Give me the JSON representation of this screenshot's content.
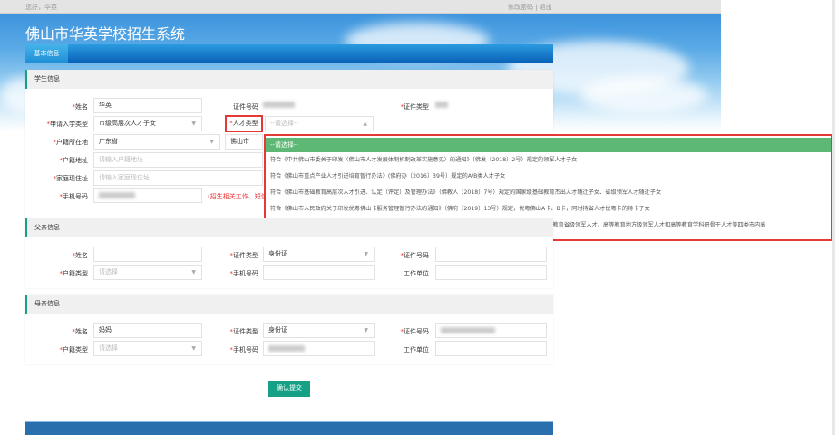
{
  "topbar": {
    "greeting": "您好，华英",
    "links": "修改密码 | 退出"
  },
  "header": {
    "title": "佛山市华英学校招生系统"
  },
  "nav": {
    "tab": "基本信息"
  },
  "student": {
    "section": "学生信息",
    "name_label": "姓名",
    "name_value": "华英",
    "id_no_label": "证件号码",
    "id_type_label": "证件类型",
    "admission_type_label": "申请入学类型",
    "admission_type_value": "市级高层次人才子女",
    "talent_type_label": "人才类型",
    "talent_type_placeholder": "--请选择--",
    "hukou_location_label": "户籍所在地",
    "province": "广东省",
    "city": "佛山市",
    "hukou_address_label": "户籍地址",
    "hukou_address_placeholder": "请输入户籍地址",
    "home_address_label": "家庭现住址",
    "home_address_placeholder": "请输入家庭现住址",
    "phone_label": "手机号码",
    "phone_hint": "(招生相关工作、短信"
  },
  "talent_dropdown": {
    "selected": "--请选择--",
    "options": [
      "符合《中共佛山市委关于印发〈佛山市人才发展体制机制改革实施意见〉的通知》（佛发〔2018〕2号）规定的领军人才子女",
      "符合《佛山市重点产业人才引进培育暂行办法》(佛府办〔2016〕39号）规定的A/B类人才子女",
      "符合《佛山市基础教育高层次人才引进、认定（评定）及管理办法》（佛教人〔2018〕7号）规定的国家级基础教育杰出人才随迁子女、省级领军人才随迁子女",
      "符合《佛山市人民政府关于印发优粤佛山卡服务管理暂行办法的通知》（佛府〔2019〕13号）规定，优粤佛山A卡、B卡，同时持省人才优粤卡的持卡子女",
      "符合《佛山市高等教育高层次人才引进扶持办法》（佛府办〔2018〕38号）规定的高等教育国家级领军人才、高等教育省级领军人才、高等教育地方级领军人才和高等教育学科研骨干人才等四类市内高"
    ]
  },
  "father": {
    "section": "父亲信息",
    "name_label": "姓名",
    "name_value": "",
    "id_type_label": "证件类型",
    "id_type_value": "身份证",
    "id_no_label": "证件号码",
    "hukou_type_label": "户籍类型",
    "hukou_type_placeholder": "请选择",
    "phone_label": "手机号码",
    "work_label": "工作单位"
  },
  "mother": {
    "section": "母亲信息",
    "name_label": "姓名",
    "name_value": "妈妈",
    "id_type_label": "证件类型",
    "id_type_value": "身份证",
    "id_no_label": "证件号码",
    "hukou_type_label": "户籍类型",
    "hukou_type_placeholder": "请选择",
    "phone_label": "手机号码",
    "work_label": "工作单位"
  },
  "submit_label": "确认提交",
  "colors": {
    "accent": "#16a085",
    "highlight": "#e53935",
    "option_selected": "#5cb874",
    "nav": "#0a62b8"
  }
}
